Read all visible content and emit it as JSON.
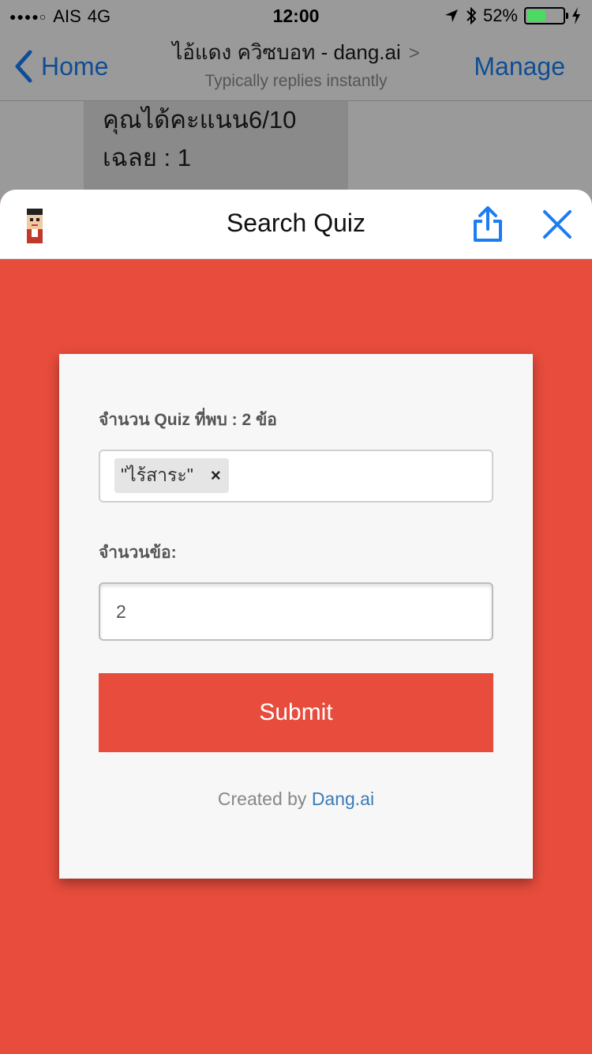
{
  "status": {
    "signal_dots": "●●●●○",
    "carrier": "AIS",
    "network": "4G",
    "time": "12:00",
    "battery_percent": "52%",
    "battery_level": 0.52
  },
  "nav": {
    "back_label": "Home",
    "title": "ไอ้แดง ควิซบอท - dang.ai",
    "chevron": ">",
    "subtitle": "Typically replies instantly",
    "manage_label": "Manage"
  },
  "chat": {
    "lines": [
      "คุณได้คะแนน6/10",
      "เฉลย : 1"
    ]
  },
  "sheet": {
    "title": "Search Quiz"
  },
  "form": {
    "found_label": "จำนวน Quiz ที่พบ : 2 ข้อ",
    "tag_text": "\"ไร้สาระ\"",
    "tag_remove": "×",
    "count_label": "จำนวนข้อ:",
    "count_value": "2",
    "submit_label": "Submit",
    "credit_prefix": "Created by ",
    "credit_link": "Dang.ai"
  },
  "colors": {
    "accent": "#e74c3c",
    "ios_blue": "#1c7cf2",
    "link": "#3b7bb8"
  }
}
